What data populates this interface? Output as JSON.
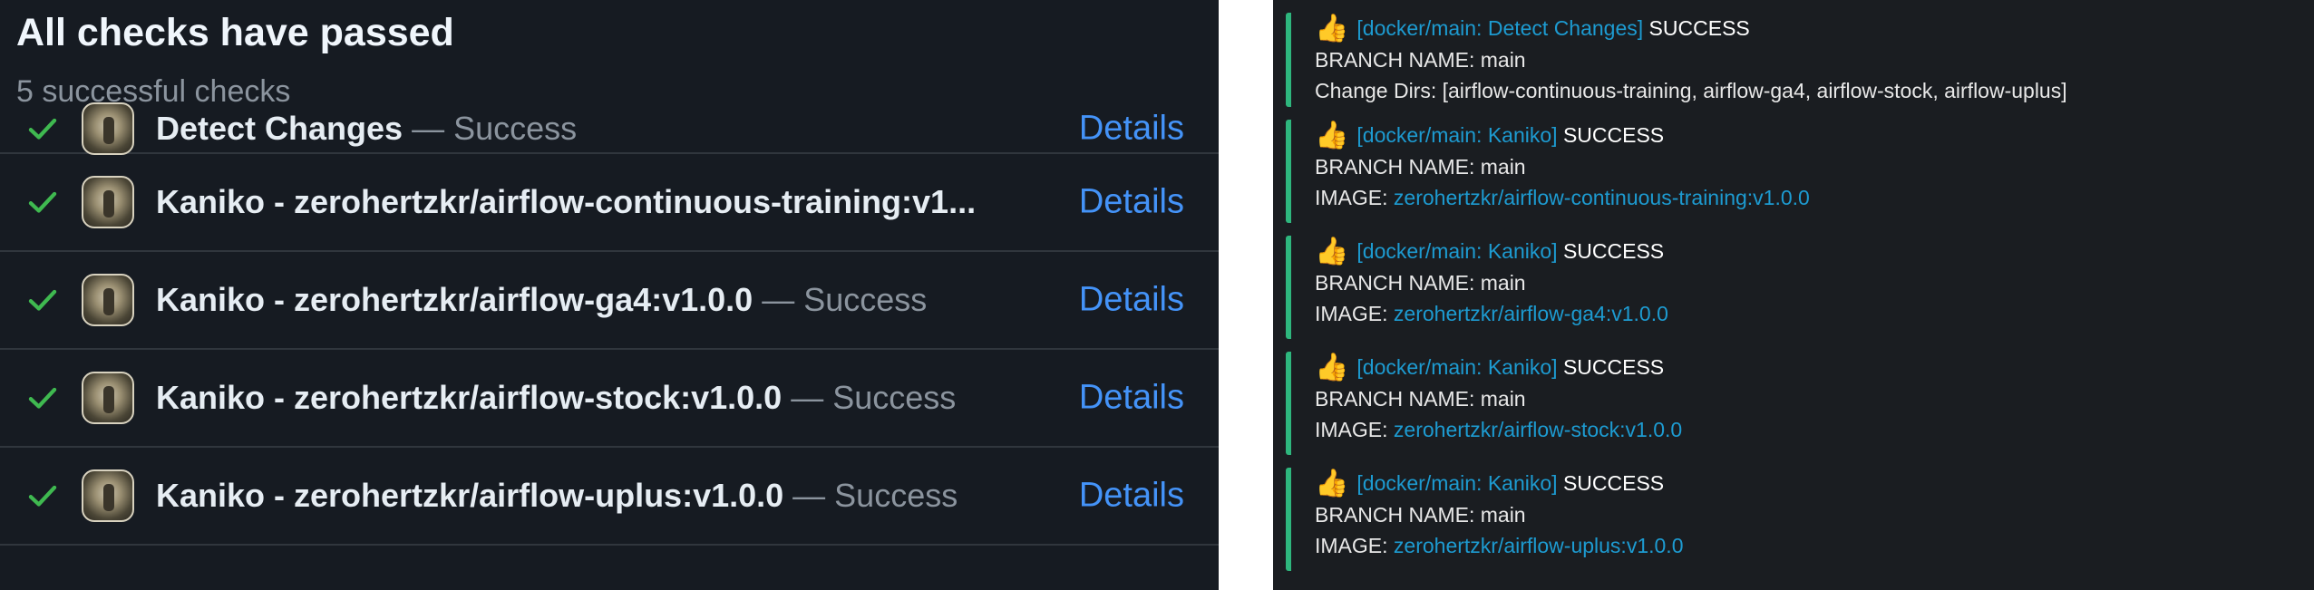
{
  "github": {
    "title": "All checks have passed",
    "subtitle": "5 successful checks",
    "checks": [
      {
        "name": "Detect Changes",
        "status": " — Success",
        "details": "Details"
      },
      {
        "name": "Kaniko - zerohertzkr/airflow-continuous-training:v1...",
        "status": "",
        "details": "Details"
      },
      {
        "name": "Kaniko - zerohertzkr/airflow-ga4:v1.0.0",
        "status": " — Success",
        "details": "Details"
      },
      {
        "name": "Kaniko - zerohertzkr/airflow-stock:v1.0.0",
        "status": " — Success",
        "details": "Details"
      },
      {
        "name": "Kaniko - zerohertzkr/airflow-uplus:v1.0.0",
        "status": " — Success",
        "details": "Details"
      }
    ]
  },
  "messages": [
    {
      "emoji": "👍",
      "tag": "[docker/main: Detect Changes]",
      "result": " SUCCESS",
      "branch": "BRANCH NAME: main",
      "extra_label": "Change Dirs: ",
      "extra_value": "[airflow-continuous-training, airflow-ga4, airflow-stock, airflow-uplus]"
    },
    {
      "emoji": "👍",
      "tag": "[docker/main: Kaniko]",
      "result": " SUCCESS",
      "branch": "BRANCH NAME: main",
      "extra_label": "IMAGE: ",
      "extra_value": "zerohertzkr/airflow-continuous-training:v1.0.0"
    },
    {
      "emoji": "👍",
      "tag": "[docker/main: Kaniko]",
      "result": " SUCCESS",
      "branch": "BRANCH NAME: main",
      "extra_label": "IMAGE: ",
      "extra_value": "zerohertzkr/airflow-ga4:v1.0.0"
    },
    {
      "emoji": "👍",
      "tag": "[docker/main: Kaniko]",
      "result": " SUCCESS",
      "branch": "BRANCH NAME: main",
      "extra_label": "IMAGE: ",
      "extra_value": "zerohertzkr/airflow-stock:v1.0.0"
    },
    {
      "emoji": "👍",
      "tag": "[docker/main: Kaniko]",
      "result": " SUCCESS",
      "branch": "BRANCH NAME: main",
      "extra_label": "IMAGE: ",
      "extra_value": "zerohertzkr/airflow-uplus:v1.0.0"
    }
  ],
  "colors": {
    "gh_bg": "#161b22",
    "gh_success": "#3fb950",
    "gh_link": "#4493f8",
    "msg_bg": "#1a1d21",
    "msg_bar": "#2eb67d",
    "msg_link": "#1d9bd1"
  },
  "icons": {
    "check": "check-icon",
    "avatar": "avatar",
    "thumbs_up": "thumbs-up-icon"
  }
}
